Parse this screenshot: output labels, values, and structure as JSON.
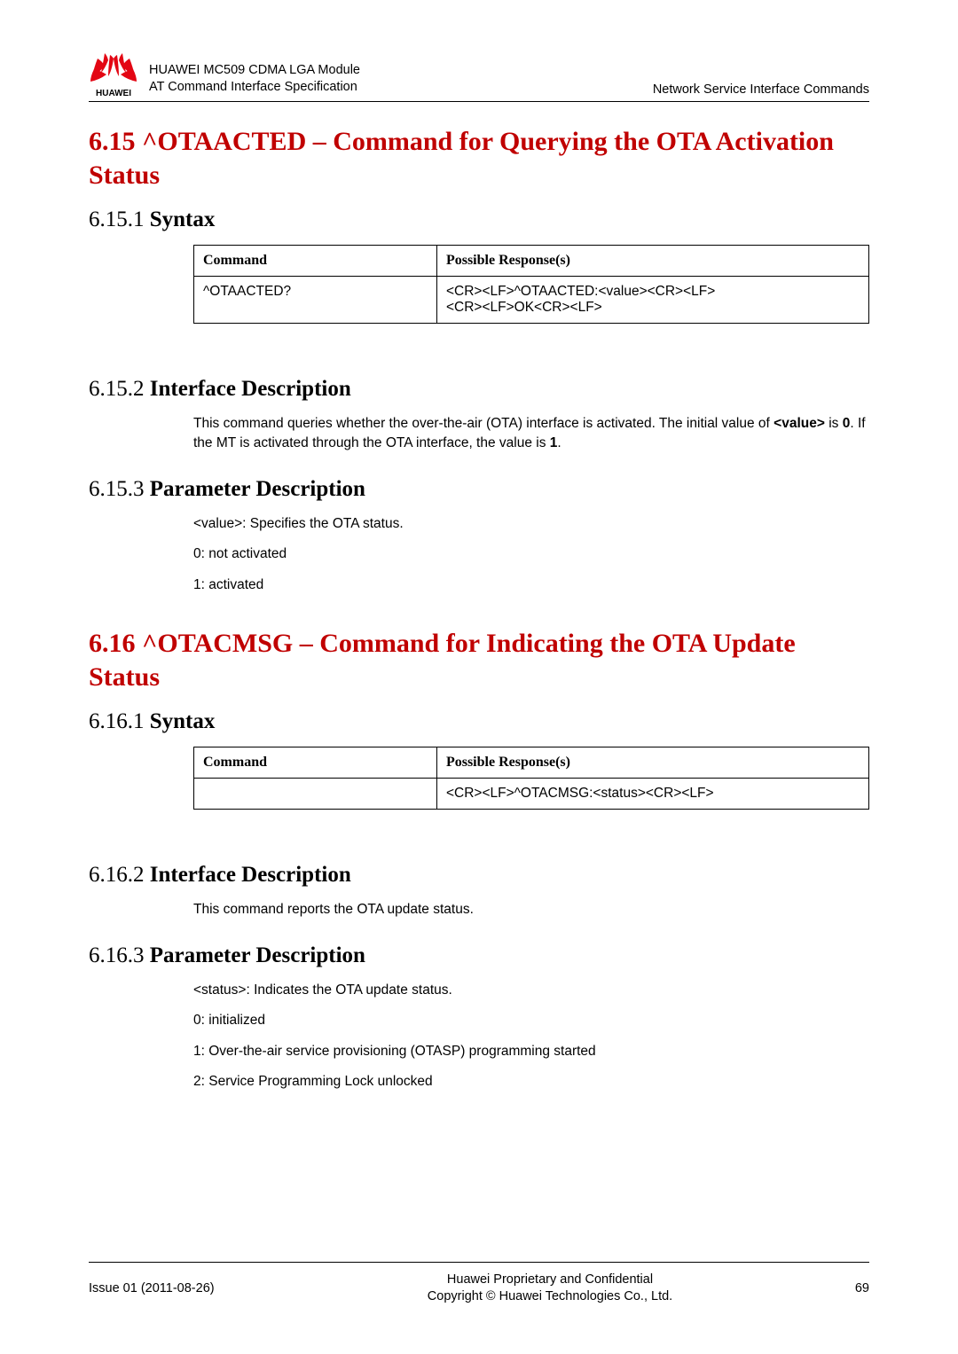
{
  "header": {
    "doc_title_line1": "HUAWEI MC509 CDMA LGA Module",
    "doc_title_line2": "AT Command Interface Specification",
    "chapter": "Network Service Interface Commands",
    "logo_text": "HUAWEI"
  },
  "section_615": {
    "heading": "6.15 ^OTAACTED – Command for Querying the OTA Activation Status",
    "syntax": {
      "num": "6.15.1 ",
      "title": "Syntax",
      "table": {
        "col1": "Command",
        "col2": "Possible Response(s)",
        "cmd": "^OTAACTED?",
        "resp_line1": "<CR><LF>^OTAACTED:<value><CR><LF>",
        "resp_line2": "<CR><LF>OK<CR><LF>"
      }
    },
    "ifdesc": {
      "num": "6.15.2 ",
      "title": "Interface Description",
      "text_pre": "This command queries whether the over-the-air (OTA) interface is activated. The initial value of ",
      "text_bold1": "<value>",
      "text_mid1": " is ",
      "text_bold2": "0",
      "text_mid2": ". If the MT is activated through the OTA interface, the value is ",
      "text_bold3": "1",
      "text_post": "."
    },
    "paramdesc": {
      "num": "6.15.3 ",
      "title": "Parameter Description",
      "p1": "<value>: Specifies the OTA status.",
      "p2": "0: not activated",
      "p3": "1: activated"
    }
  },
  "section_616": {
    "heading": "6.16 ^OTACMSG – Command for Indicating the OTA Update Status",
    "syntax": {
      "num": "6.16.1 ",
      "title": "Syntax",
      "table": {
        "col1": "Command",
        "col2": "Possible Response(s)",
        "cmd": "",
        "resp": "<CR><LF>^OTACMSG:<status><CR><LF>"
      }
    },
    "ifdesc": {
      "num": "6.16.2 ",
      "title": "Interface Description",
      "text": "This command reports the OTA update status."
    },
    "paramdesc": {
      "num": "6.16.3 ",
      "title": "Parameter Description",
      "p1": "<status>: Indicates the OTA update status.",
      "p2": "0: initialized",
      "p3": "1: Over-the-air service provisioning (OTASP) programming started",
      "p4": "2: Service Programming Lock unlocked"
    }
  },
  "footer": {
    "issue": "Issue 01 (2011-08-26)",
    "center_line1": "Huawei Proprietary and Confidential",
    "center_line2": "Copyright © Huawei Technologies Co., Ltd.",
    "page": "69"
  }
}
